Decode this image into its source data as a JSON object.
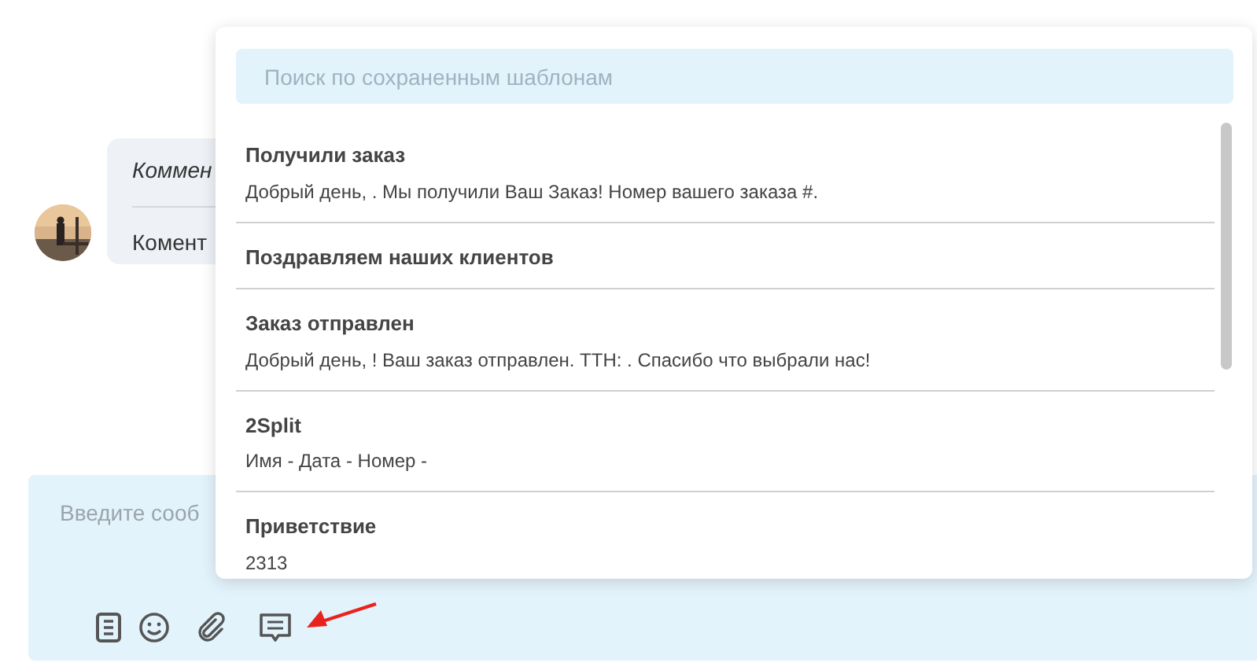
{
  "comment": {
    "title": "Коммен",
    "text": "Комент"
  },
  "composer": {
    "placeholder": "Введите сооб"
  },
  "templates_popup": {
    "search": {
      "placeholder": "Поиск по сохраненным шаблонам"
    },
    "items": [
      {
        "title": "Получили заказ",
        "text": "Добрый день, . Мы получили Ваш Заказ! Номер вашего заказа #."
      },
      {
        "title": "Поздравляем наших клиентов"
      },
      {
        "title": "Заказ отправлен",
        "text": "Добрый день, ! Ваш заказ отправлен. ТТН: . Спасибо что выбрали нас!"
      },
      {
        "title": "2Split",
        "text": "Имя - Дата - Номер -"
      },
      {
        "title": "Приветствие",
        "text": "2313"
      }
    ]
  }
}
